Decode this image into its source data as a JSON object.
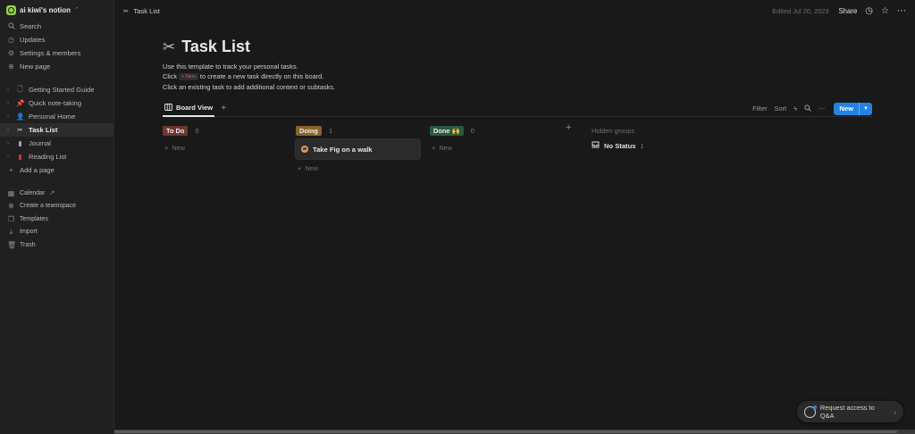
{
  "workspace": {
    "name": "ai kiwi's notion"
  },
  "sidebar": {
    "nav": [
      {
        "label": "Search",
        "icon": "search-icon"
      },
      {
        "label": "Updates",
        "icon": "clock-icon"
      },
      {
        "label": "Settings & members",
        "icon": "gear-icon"
      },
      {
        "label": "New page",
        "icon": "plus-circle-icon"
      }
    ],
    "pages": [
      {
        "label": "Getting Started Guide",
        "icon": "document-icon"
      },
      {
        "label": "Quick note-taking",
        "icon": "pushpin-icon"
      },
      {
        "label": "Personal Home",
        "icon": "person-icon"
      },
      {
        "label": "Task List",
        "icon": "scissors-icon"
      },
      {
        "label": "Journal",
        "icon": "notebook-icon"
      },
      {
        "label": "Reading List",
        "icon": "book-icon"
      }
    ],
    "add_page": "Add a page",
    "bottom": [
      {
        "label": "Calendar",
        "icon": "calendar-icon"
      },
      {
        "label": "Create a teamspace",
        "icon": "teamspace-icon"
      },
      {
        "label": "Templates",
        "icon": "template-icon"
      },
      {
        "label": "Import",
        "icon": "import-icon"
      },
      {
        "label": "Trash",
        "icon": "trash-icon"
      }
    ]
  },
  "topbar": {
    "breadcrumb": "Task List",
    "edited": "Edited Jul 20, 2023",
    "share": "Share"
  },
  "page": {
    "title": "Task List",
    "desc_line1": "Use this template to track your personal tasks.",
    "desc_line2_pre": "Click",
    "desc_line2_new": "+ New",
    "desc_line2_post": "to create a new task directly on this board.",
    "desc_line3": "Click an existing task to add additional context or subtasks."
  },
  "view": {
    "tab": "Board View",
    "filter": "Filter",
    "sort": "Sort",
    "new_button": "New"
  },
  "board": {
    "columns": [
      {
        "name": "To Do",
        "count": "0",
        "cards": [],
        "add_label": "New"
      },
      {
        "name": "Doing",
        "count": "1",
        "cards": [
          {
            "title": "Take Fig on a walk"
          }
        ],
        "add_label": "New"
      },
      {
        "name": "Done 🙌",
        "count": "0",
        "cards": [],
        "add_label": "New"
      }
    ],
    "hidden_groups_title": "Hidden groups",
    "hidden_groups": [
      {
        "name": "No Status",
        "count": "1"
      }
    ]
  },
  "request_access": {
    "label": "Request access to Q&A"
  },
  "colors": {
    "accent": "#2383e2",
    "todo": "#6e3630",
    "doing": "#89632a",
    "done": "#2b593f"
  }
}
